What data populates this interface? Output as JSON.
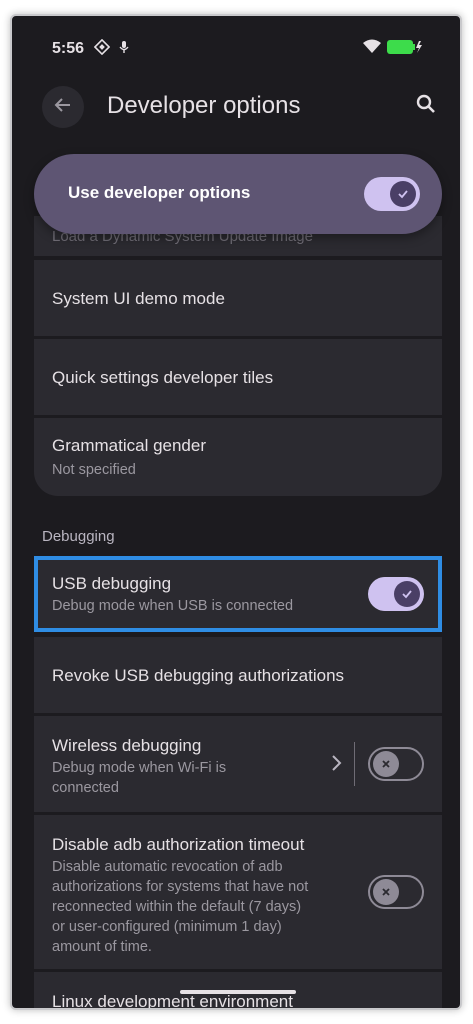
{
  "status_bar": {
    "time": "5:56",
    "icons": [
      "location-diamond-icon",
      "mic-icon",
      "wifi-icon",
      "battery-charging-icon"
    ]
  },
  "app_bar": {
    "title": "Developer options",
    "back_icon": "arrow-left-icon",
    "search_icon": "search-icon"
  },
  "master_toggle": {
    "label": "Use developer options",
    "state": "on"
  },
  "peek_item": {
    "label": "Load a Dynamic System Update Image"
  },
  "items_top": [
    {
      "title": "System UI demo mode"
    },
    {
      "title": "Quick settings developer tiles"
    },
    {
      "title": "Grammatical gender",
      "subtitle": "Not specified"
    }
  ],
  "debugging": {
    "header": "Debugging",
    "usb_debugging": {
      "title": "USB debugging",
      "subtitle": "Debug mode when USB is connected",
      "state": "on"
    },
    "revoke": {
      "title": "Revoke USB debugging authorizations"
    },
    "wireless": {
      "title": "Wireless debugging",
      "subtitle_line1": "Debug mode when Wi-Fi is",
      "subtitle_line2": "connected",
      "state": "off"
    },
    "adb_timeout": {
      "title": "Disable adb authorization timeout",
      "subtitle_lines": [
        "Disable automatic revocation of adb",
        "authorizations for systems that have not",
        "reconnected within the default (7 days)",
        "or user-configured (minimum 1 day)",
        "amount of time."
      ],
      "state": "off"
    },
    "linux": {
      "title": "Linux development environment"
    }
  },
  "colors": {
    "background": "#1c1b1f",
    "card": "#2b2a30",
    "master": "#5e5573",
    "toggle_on": "#cfc2f0",
    "highlight_border": "#2f8de4",
    "battery": "#3ddc4b"
  }
}
